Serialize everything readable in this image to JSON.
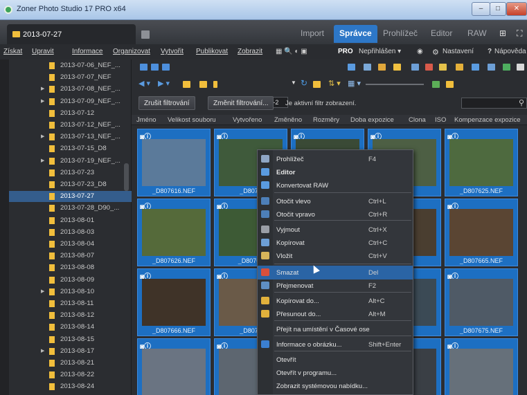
{
  "window": {
    "title": "Zoner Photo Studio 17 PRO x64",
    "btn_minimize": "–",
    "btn_maximize": "□",
    "btn_close": "✕"
  },
  "tabs": {
    "folder_tab": "2013-07-27",
    "modules": [
      "Import",
      "Správce",
      "Prohlížeč",
      "Editor",
      "RAW"
    ],
    "active_module": "Správce"
  },
  "menu": {
    "items": [
      "Získat",
      "Upravit",
      "Informace",
      "Organizovat",
      "Vytvořit",
      "Publikovat",
      "Zobrazit"
    ],
    "pro": "PRO",
    "login": "Nepřihlášen ▾",
    "settings": "Nastavení",
    "help": "Nápověda"
  },
  "sidebar": {
    "items": [
      {
        "label": "2013-07-06_NEF_...",
        "arrow": ""
      },
      {
        "label": "2013-07-07_NEF",
        "arrow": ""
      },
      {
        "label": "2013-07-08_NEF_...",
        "arrow": "▶"
      },
      {
        "label": "2013-07-09_NEF_...",
        "arrow": "▶"
      },
      {
        "label": "2013-07-12",
        "arrow": ""
      },
      {
        "label": "2013-07-12_NEF_...",
        "arrow": ""
      },
      {
        "label": "2013-07-13_NEF_...",
        "arrow": "▶"
      },
      {
        "label": "2013-07-15_D8",
        "arrow": ""
      },
      {
        "label": "2013-07-19_NEF_...",
        "arrow": "▶"
      },
      {
        "label": "2013-07-23",
        "arrow": ""
      },
      {
        "label": "2013-07-23_D8",
        "arrow": ""
      },
      {
        "label": "2013-07-27",
        "arrow": ""
      },
      {
        "label": "2013-07-28_D90_...",
        "arrow": ""
      },
      {
        "label": "2013-08-01",
        "arrow": ""
      },
      {
        "label": "2013-08-03",
        "arrow": ""
      },
      {
        "label": "2013-08-04",
        "arrow": ""
      },
      {
        "label": "2013-08-07",
        "arrow": ""
      },
      {
        "label": "2013-08-08",
        "arrow": ""
      },
      {
        "label": "2013-08-09",
        "arrow": ""
      },
      {
        "label": "2013-08-10",
        "arrow": "▶"
      },
      {
        "label": "2013-08-11",
        "arrow": ""
      },
      {
        "label": "2013-08-12",
        "arrow": ""
      },
      {
        "label": "2013-08-14",
        "arrow": ""
      },
      {
        "label": "2013-08-15",
        "arrow": ""
      },
      {
        "label": "2013-08-17",
        "arrow": "▶"
      },
      {
        "label": "2013-08-21",
        "arrow": ""
      },
      {
        "label": "2013-08-22",
        "arrow": ""
      },
      {
        "label": "2013-08-24",
        "arrow": ""
      }
    ],
    "selected": "2013-07-27"
  },
  "toolbar": {
    "path": "E:\\FOTO\\2013-07-2"
  },
  "filter": {
    "cancel_filter": "Zrušit filtrování",
    "change_filter": "Změnit filtrování...",
    "status": "Je aktivní filtr zobrazení."
  },
  "columns": [
    "Jméno",
    "Velikost souboru",
    "Vytvořeno",
    "Změněno",
    "Rozměry",
    "Doba expozice",
    "Clona",
    "ISO",
    "Kompenzace expozice"
  ],
  "thumbnails": [
    {
      "caption": "_D807616.NEF",
      "overlay": "◙ⓘ"
    },
    {
      "caption": "_D8076",
      "overlay": "◙ⓘ"
    },
    {
      "caption": "",
      "overlay": "◙ⓘ"
    },
    {
      "caption": "",
      "overlay": "◙ⓘ"
    },
    {
      "caption": "_D807625.NEF",
      "overlay": "◙ⓘ"
    },
    {
      "caption": "_D807626.NEF",
      "overlay": "◙ⓘ"
    },
    {
      "caption": "_D80762",
      "overlay": "◙ⓘ"
    },
    {
      "caption": "",
      "overlay": ""
    },
    {
      "caption": "NEF",
      "overlay": ""
    },
    {
      "caption": "_D807665.NEF",
      "overlay": "◙ⓘ"
    },
    {
      "caption": "_D807666.NEF",
      "overlay": "◙ⓘ"
    },
    {
      "caption": "_D8078",
      "overlay": "◙ⓘ"
    },
    {
      "caption": "",
      "overlay": ""
    },
    {
      "caption": "NEF",
      "overlay": ""
    },
    {
      "caption": "_D807675.NEF",
      "overlay": "◙ⓘ"
    },
    {
      "caption": "",
      "overlay": "◙ⓘ"
    },
    {
      "caption": "",
      "overlay": "◙ⓘ"
    },
    {
      "caption": "",
      "overlay": ""
    },
    {
      "caption": "",
      "overlay": ""
    },
    {
      "caption": "",
      "overlay": "◙ⓘ"
    }
  ],
  "context_menu": [
    {
      "label": "Prohlížeč",
      "shortcut": "F4",
      "icon_color": "#8fa6c4"
    },
    {
      "label": "Editor",
      "shortcut": "",
      "icon_color": "#5a9be0"
    },
    {
      "label": "Konvertovat RAW",
      "shortcut": "",
      "icon_color": "#5a9be0"
    },
    {
      "label": "Otočit vlevo",
      "shortcut": "Ctrl+L",
      "icon_color": "#4d7fb8"
    },
    {
      "label": "Otočit vpravo",
      "shortcut": "Ctrl+R",
      "icon_color": "#4d7fb8"
    },
    {
      "label": "Vyjmout",
      "shortcut": "Ctrl+X",
      "icon_color": "#9a9ea6"
    },
    {
      "label": "Kopírovat",
      "shortcut": "Ctrl+C",
      "icon_color": "#6d9fd6"
    },
    {
      "label": "Vložit",
      "shortcut": "Ctrl+V",
      "icon_color": "#d6b45a"
    },
    {
      "label": "Smazat",
      "shortcut": "Del",
      "icon_color": "#d84f3b"
    },
    {
      "label": "Přejmenovat",
      "shortcut": "F2",
      "icon_color": "#5f8fc4"
    },
    {
      "label": "Kopírovat do...",
      "shortcut": "Alt+C",
      "icon_color": "#e1b13c"
    },
    {
      "label": "Přesunout do...",
      "shortcut": "Alt+M",
      "icon_color": "#e1b13c"
    },
    {
      "label": "Přejít na umístění v Časové ose",
      "shortcut": "",
      "icon_color": ""
    },
    {
      "label": "Informace o obrázku...",
      "shortcut": "Shift+Enter",
      "icon_color": "#3b7fd0"
    },
    {
      "label": "Otevřít",
      "shortcut": "",
      "icon_color": ""
    },
    {
      "label": "Otevřít v programu...",
      "shortcut": "",
      "icon_color": ""
    },
    {
      "label": "Zobrazit systémovou nabídku...",
      "shortcut": "",
      "icon_color": ""
    },
    {
      "label": "Vlastnosti...",
      "shortcut": "Alt+Enter",
      "icon_color": "#c9a24c"
    }
  ],
  "context_highlight": "Smazat"
}
